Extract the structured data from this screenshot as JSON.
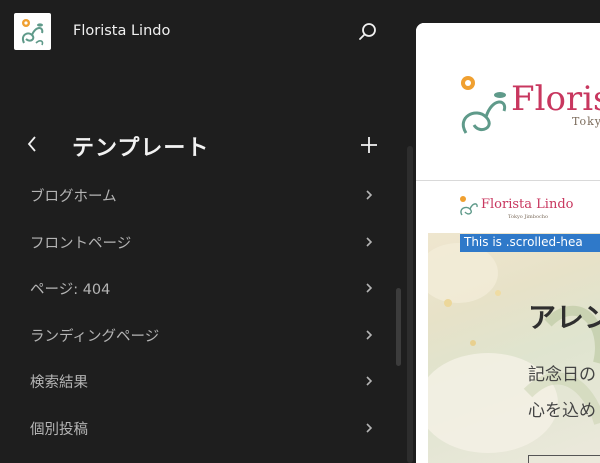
{
  "app": {
    "site_title": "Florista Lindo",
    "logo_icon": "florista-lindo-logo-icon",
    "search_icon": "search-icon"
  },
  "panel": {
    "title": "テンプレート",
    "back_icon": "chevron-left-icon",
    "add_icon": "plus-icon",
    "items": [
      {
        "label": "ブログホーム"
      },
      {
        "label": "フロントページ"
      },
      {
        "label": "ページ: 404"
      },
      {
        "label": "ランディングページ"
      },
      {
        "label": "検索結果"
      },
      {
        "label": "個別投稿"
      }
    ],
    "item_icon": "chevron-right-icon"
  },
  "preview": {
    "brand_main": "Floris",
    "brand_tagline": "Toky",
    "brand_small": "Florista Lindo",
    "brand_small_tagline": "Tokyo Jimbocho",
    "scrolled_note": "This is .scrolled-hea",
    "hero_title": "アレン",
    "hero_line1": "記念日の",
    "hero_line2": "心を込め"
  },
  "colors": {
    "sidebar_bg": "#1e1e1e",
    "brand_pink": "#c8375f",
    "leaf_teal": "#5f9a8a",
    "flower_orange": "#f0a030",
    "note_blue": "#2f79c9"
  }
}
